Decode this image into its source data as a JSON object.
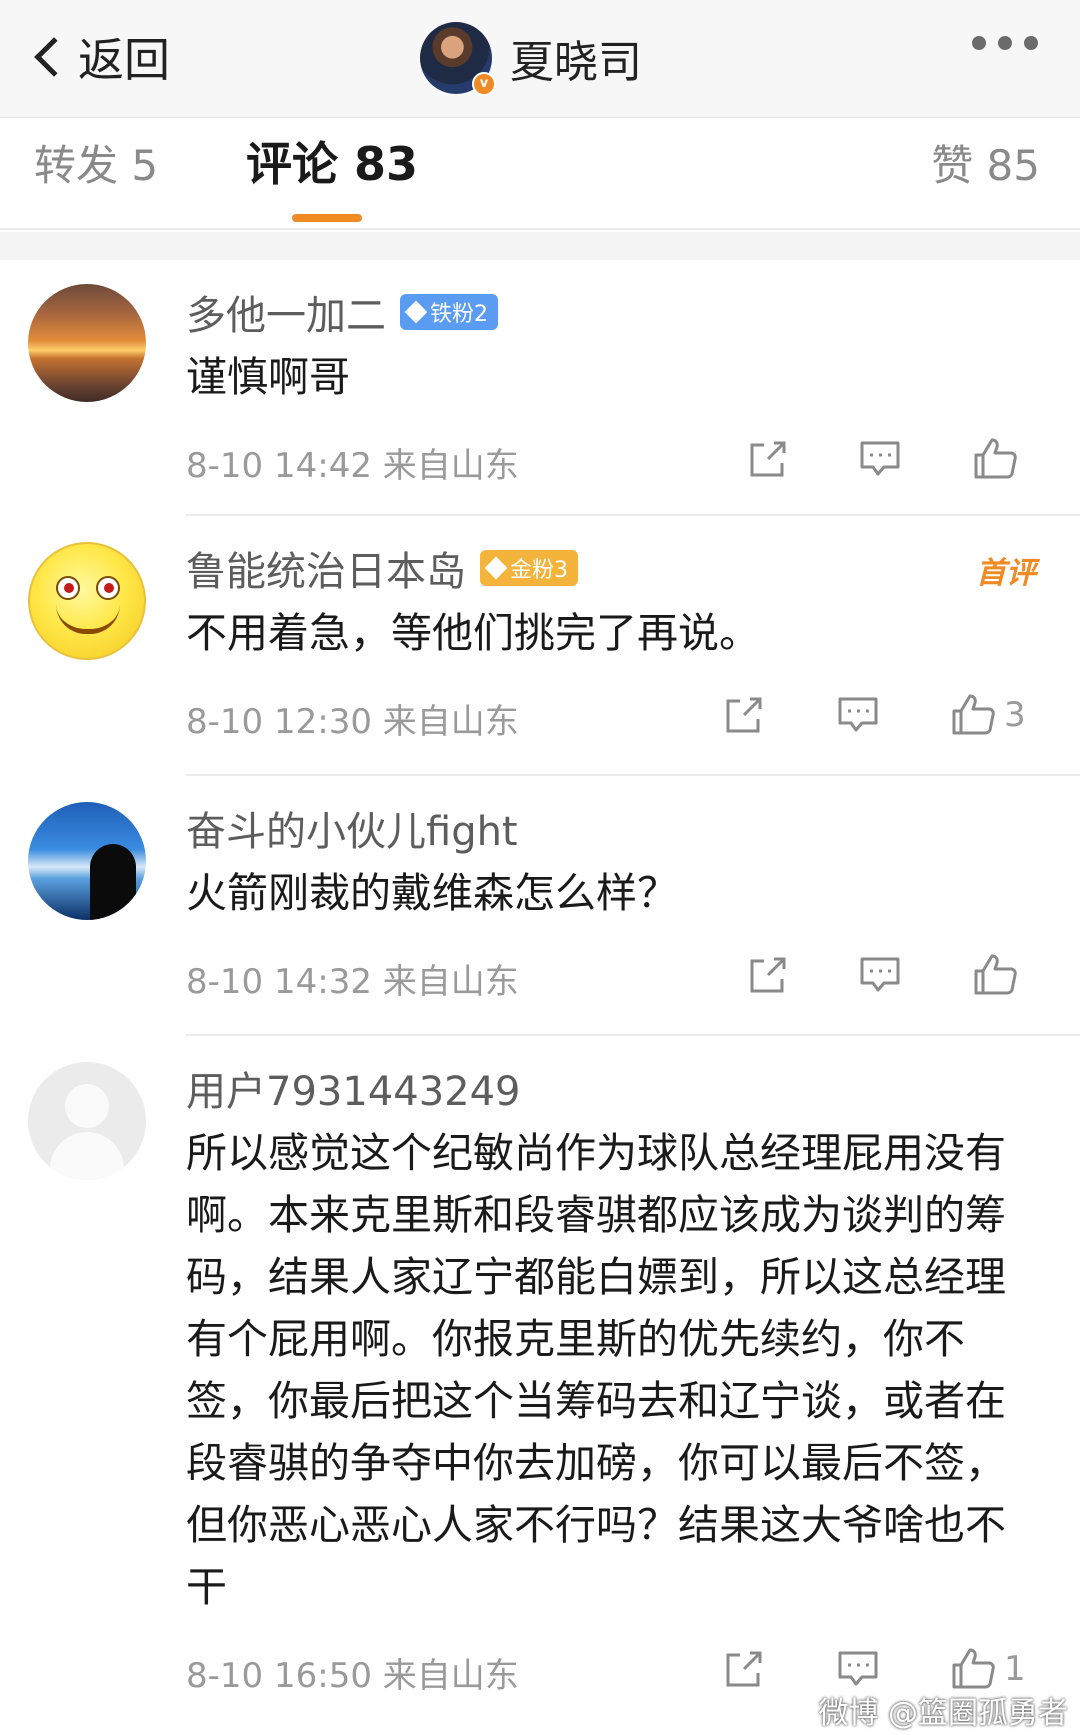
{
  "header": {
    "back_label": "返回",
    "title": "夏晓司",
    "verified_badge": "v",
    "more_icon": "more-dots-icon"
  },
  "tabs": [
    {
      "label": "转发 5",
      "active": false
    },
    {
      "label": "评论 83",
      "active": true
    },
    {
      "label": "赞 85",
      "active": false
    }
  ],
  "colors": {
    "accent": "#f08a24",
    "meta": "#9a9a9a",
    "iron_badge": "#5a9cf2",
    "gold_badge": "#f4b43c"
  },
  "comments": [
    {
      "username": "多他一加二",
      "badge": "铁粉2",
      "text": "谨慎啊哥",
      "meta": "8-10 14:42 来自山东",
      "likes": ""
    },
    {
      "username": "鲁能统治日本岛",
      "badge": "金粉3",
      "tag": "首评",
      "text": "不用着急，等他们挑完了再说。",
      "meta": "8-10 12:30 来自山东",
      "likes": "3"
    },
    {
      "username": "奋斗的小伙儿fight",
      "text": "火箭刚裁的戴维森怎么样？",
      "meta": "8-10 14:32 来自山东",
      "likes": ""
    },
    {
      "username": "用户7931443249",
      "text": "所以感觉这个纪敏尚作为球队总经理屁用没有啊。本来克里斯和段睿骐都应该成为谈判的筹码，结果人家辽宁都能白嫖到，所以这总经理有个屁用啊。你报克里斯的优先续约，你不签，你最后把这个当筹码去和辽宁谈，或者在段睿骐的争夺中你去加磅，你可以最后不签，但你恶心恶心人家不行吗？结果这大爷啥也不干",
      "meta": "8-10 16:50 来自山东",
      "likes": "1"
    }
  ],
  "watermark": "微博 @篮圈孤勇者"
}
